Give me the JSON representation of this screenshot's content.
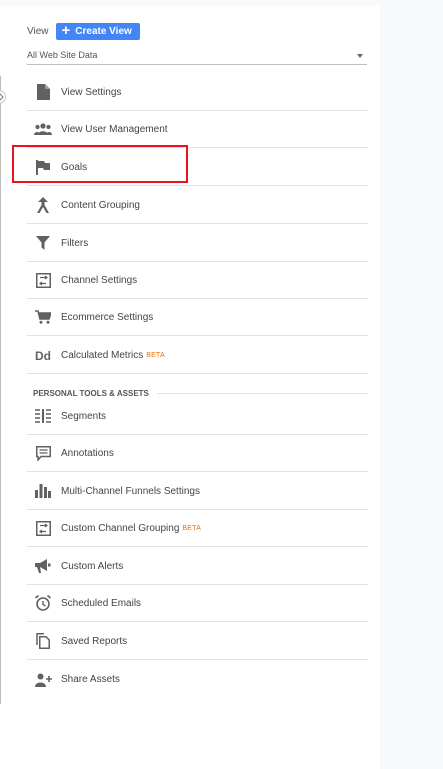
{
  "header": {
    "view_label": "View",
    "create_view_label": "Create View",
    "selected_view": "All Web Site Data"
  },
  "menu": [
    {
      "label": "View Settings",
      "icon": "document-icon"
    },
    {
      "label": "View User Management",
      "icon": "users-icon"
    },
    {
      "label": "Goals",
      "icon": "flag-icon"
    },
    {
      "label": "Content Grouping",
      "icon": "merge-icon"
    },
    {
      "label": "Filters",
      "icon": "filter-icon"
    },
    {
      "label": "Channel Settings",
      "icon": "channel-icon"
    },
    {
      "label": "Ecommerce Settings",
      "icon": "cart-icon"
    },
    {
      "label": "Calculated Metrics",
      "icon": "dd-icon",
      "badge": "BETA"
    }
  ],
  "personal_section": {
    "title": "PERSONAL TOOLS & ASSETS",
    "items": [
      {
        "label": "Segments",
        "icon": "segments-icon"
      },
      {
        "label": "Annotations",
        "icon": "annotation-icon"
      },
      {
        "label": "Multi-Channel Funnels Settings",
        "icon": "bar-chart-icon"
      },
      {
        "label": "Custom Channel Grouping",
        "icon": "channel-icon",
        "badge": "BETA"
      },
      {
        "label": "Custom Alerts",
        "icon": "megaphone-icon"
      },
      {
        "label": "Scheduled Emails",
        "icon": "alarm-clock-icon"
      },
      {
        "label": "Saved Reports",
        "icon": "copy-document-icon"
      },
      {
        "label": "Share Assets",
        "icon": "add-person-icon"
      }
    ]
  },
  "colors": {
    "accent": "#4285f4",
    "highlight": "#e8141a",
    "beta": "#e8710a",
    "icon": "#616161"
  }
}
